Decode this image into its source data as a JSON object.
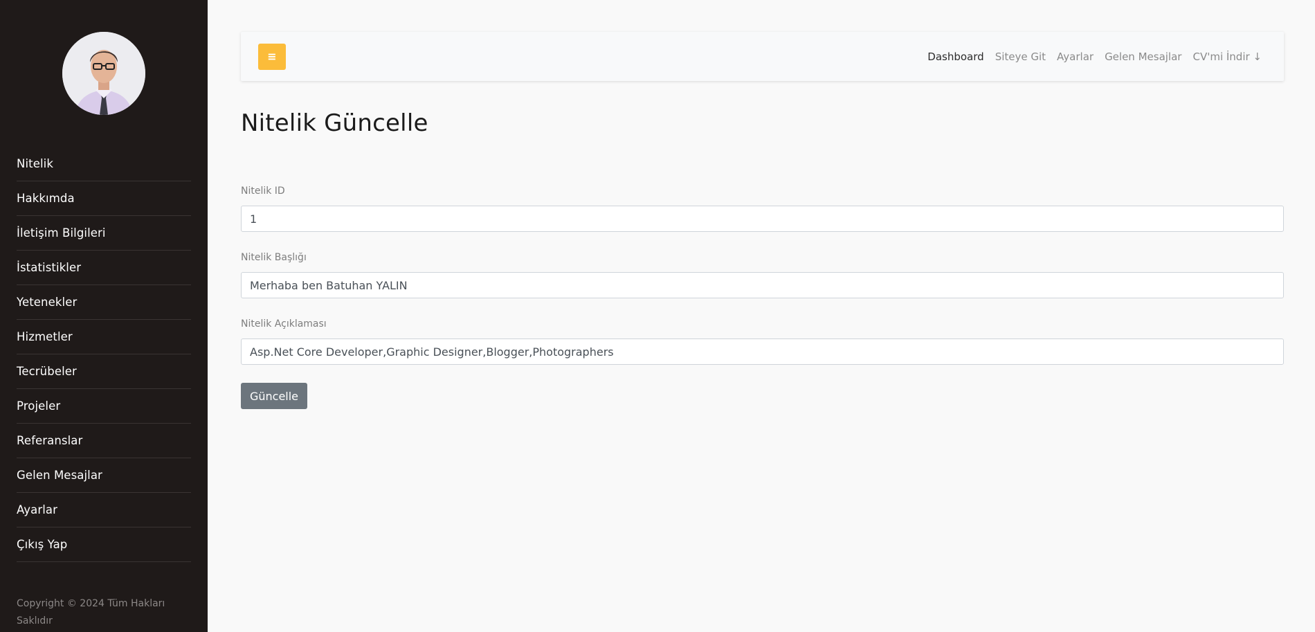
{
  "sidebar": {
    "items": [
      {
        "label": "Nitelik"
      },
      {
        "label": "Hakkımda"
      },
      {
        "label": "İletişim Bilgileri"
      },
      {
        "label": "İstatistikler"
      },
      {
        "label": "Yetenekler"
      },
      {
        "label": "Hizmetler"
      },
      {
        "label": "Tecrübeler"
      },
      {
        "label": "Projeler"
      },
      {
        "label": "Referanslar"
      },
      {
        "label": "Gelen Mesajlar"
      },
      {
        "label": "Ayarlar"
      },
      {
        "label": "Çıkış Yap"
      }
    ],
    "copyright": "Copyright © 2024 Tüm Hakları Saklıdır"
  },
  "navbar": {
    "toggle_icon": "hamburger-menu-icon",
    "toggle_symbol": "≡",
    "links": [
      {
        "label": "Dashboard"
      },
      {
        "label": "Siteye Git"
      },
      {
        "label": "Ayarlar"
      },
      {
        "label": "Gelen Mesajlar"
      },
      {
        "label": "CV'mi İndir ↓"
      }
    ]
  },
  "form": {
    "title": "Nitelik Güncelle",
    "fields": [
      {
        "label": "Nitelik ID",
        "value": "1"
      },
      {
        "label": "Nitelik Başlığı",
        "value": "Merhaba ben Batuhan YALIN"
      },
      {
        "label": "Nitelik Açıklaması",
        "value": "Asp.Net Core Developer,Graphic Designer,Blogger,Photographers"
      }
    ],
    "submit_label": "Güncelle"
  },
  "colors": {
    "sidebar_bg": "#1f1a19",
    "accent": "#fbbc3a",
    "submit_bg": "#6c757d"
  }
}
